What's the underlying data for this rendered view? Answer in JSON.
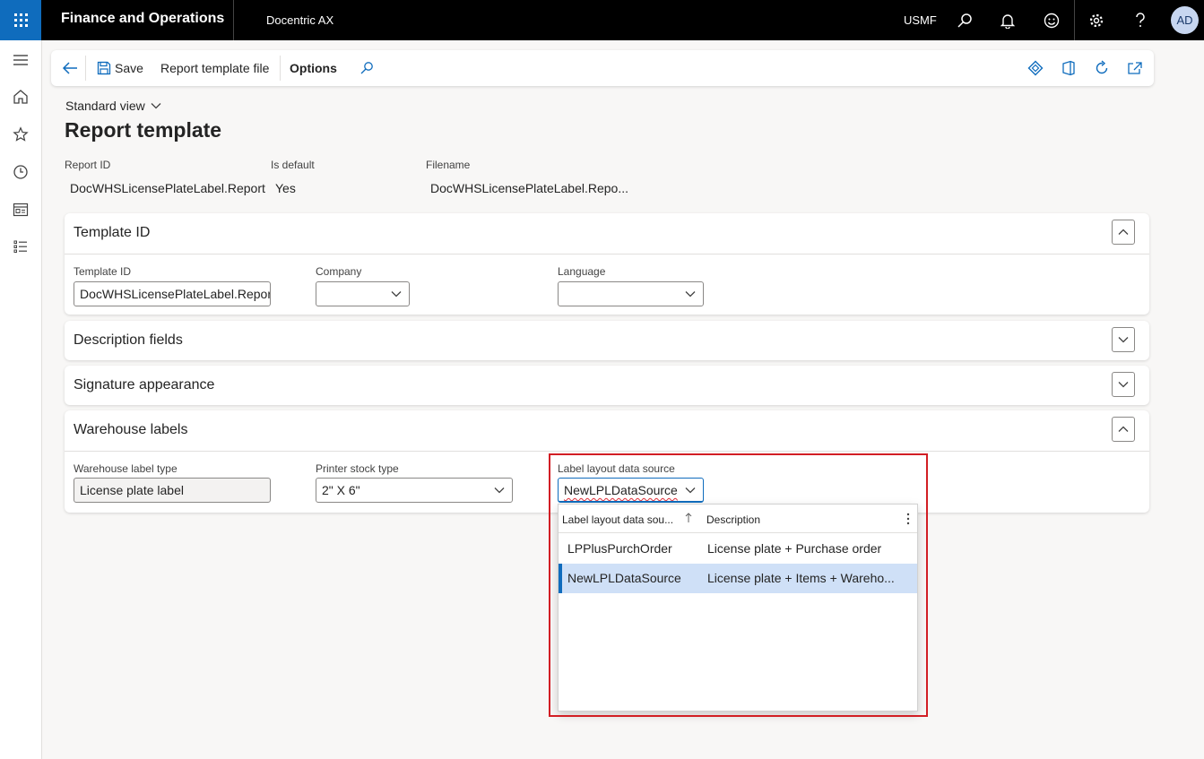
{
  "topbar": {
    "app_title": "Finance and Operations",
    "module": "Docentric AX",
    "company": "USMF",
    "avatar_initials": "AD"
  },
  "actionpane": {
    "save_label": "Save",
    "report_template_file_label": "Report template file",
    "options_label": "Options"
  },
  "header": {
    "view_label": "Standard view",
    "page_title": "Report template",
    "fields": [
      {
        "label": "Report ID",
        "value": "DocWHSLicensePlateLabel.Report"
      },
      {
        "label": "Is default",
        "value": "Yes"
      },
      {
        "label": "Filename",
        "value": "DocWHSLicensePlateLabel.Repo..."
      }
    ]
  },
  "sections": {
    "template_id": {
      "title": "Template ID",
      "fields": [
        {
          "label": "Template ID",
          "value": "DocWHSLicensePlateLabel.Report"
        },
        {
          "label": "Company",
          "value": ""
        },
        {
          "label": "Language",
          "value": ""
        }
      ]
    },
    "description_fields": {
      "title": "Description fields"
    },
    "signature_appearance": {
      "title": "Signature appearance"
    },
    "warehouse_labels": {
      "title": "Warehouse labels",
      "fields": [
        {
          "label": "Warehouse label type",
          "value": "License plate label"
        },
        {
          "label": "Printer stock type",
          "value": "2\" X 6\""
        },
        {
          "label": "Label layout data source",
          "value": "NewLPLDataSource"
        }
      ]
    }
  },
  "lookup": {
    "columns": [
      "Label layout data sou...",
      "Description"
    ],
    "rows": [
      {
        "name": "LPPlusPurchOrder",
        "description": "License plate + Purchase order",
        "selected": false
      },
      {
        "name": "NewLPLDataSource",
        "description": "License plate + Items + Wareho...",
        "selected": true
      }
    ]
  },
  "colors": {
    "accent": "#0f6cbd",
    "highlight": "#d21e24",
    "selected_row": "#cfe0f7"
  }
}
